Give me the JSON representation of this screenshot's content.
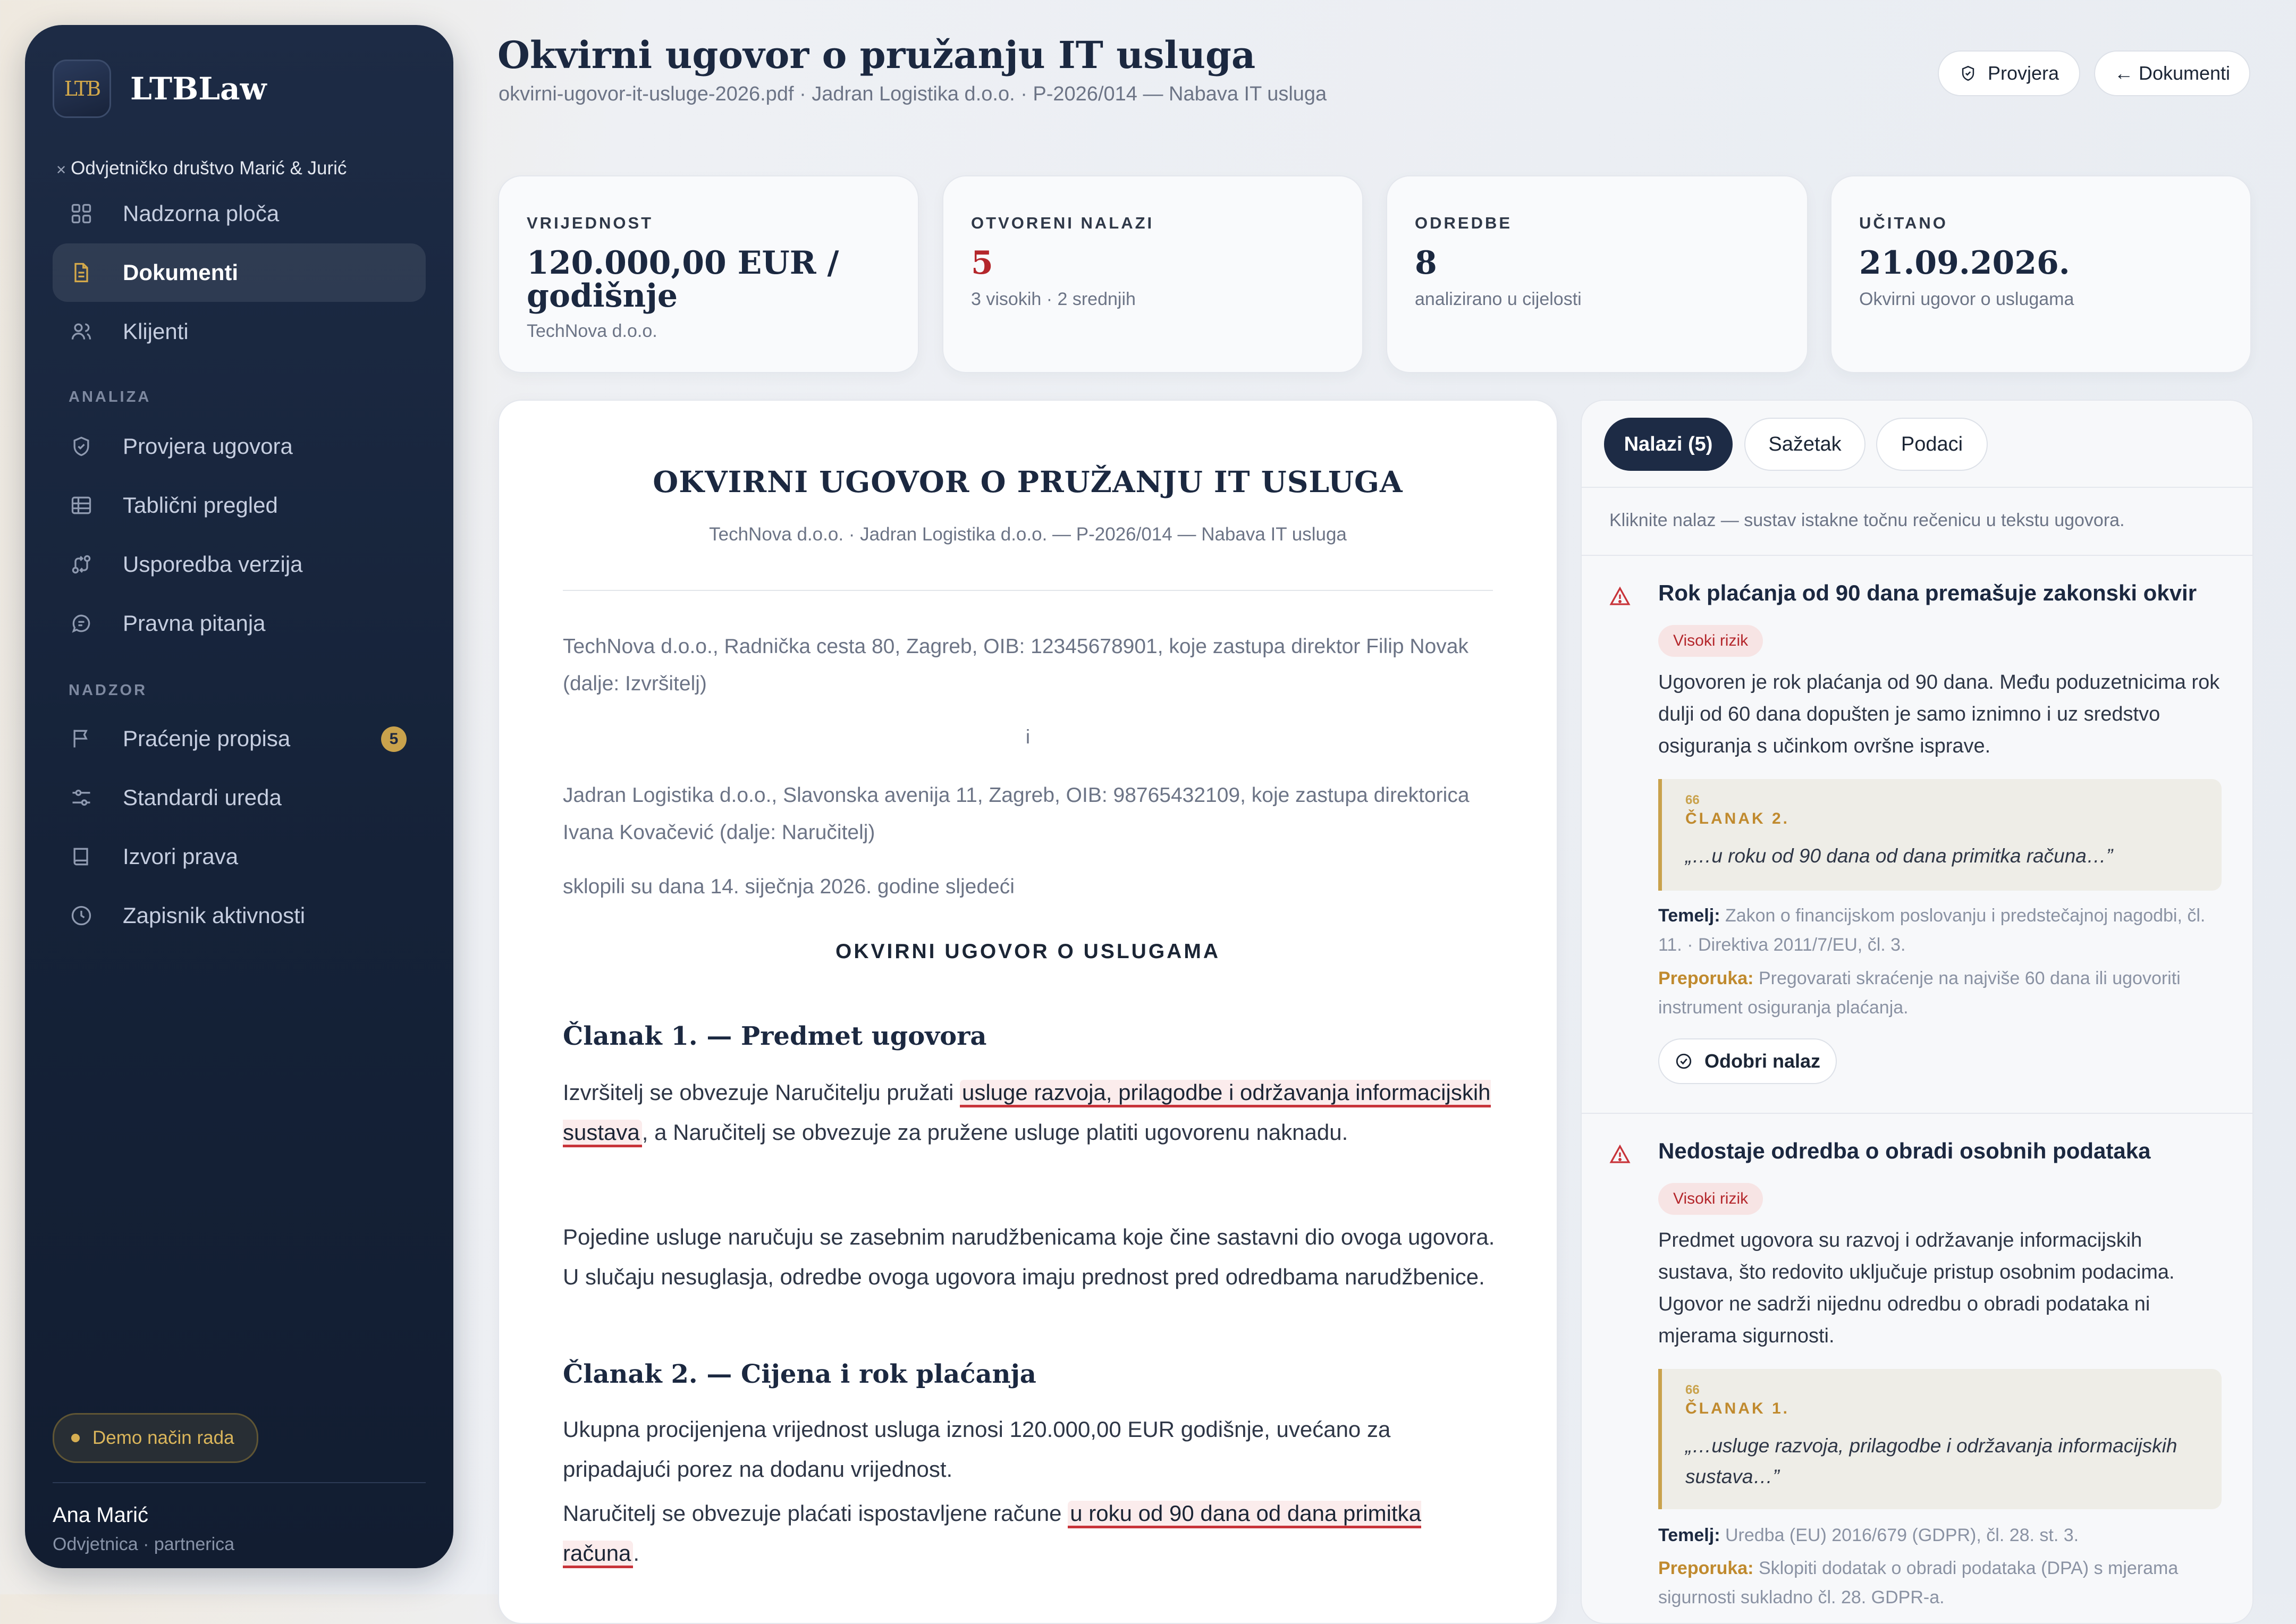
{
  "app": {
    "name": "LTBLaw",
    "logo_text": "LTB",
    "firm": "Odvjetničko društvo Marić & Jurić"
  },
  "nav": {
    "main": [
      {
        "label": "Nadzorna ploča",
        "icon": "dashboard-icon"
      },
      {
        "label": "Dokumenti",
        "icon": "document-icon",
        "active": true
      },
      {
        "label": "Klijenti",
        "icon": "users-icon"
      }
    ],
    "section_analysis": "ANALIZA",
    "analysis": [
      {
        "label": "Provjera ugovora",
        "icon": "shield-icon"
      },
      {
        "label": "Tablični pregled",
        "icon": "table-icon"
      },
      {
        "label": "Usporedba verzija",
        "icon": "compare-icon"
      },
      {
        "label": "Pravna pitanja",
        "icon": "chat-icon"
      }
    ],
    "section_monitor": "NADZOR",
    "monitor": [
      {
        "label": "Praćenje propisa",
        "icon": "flag-icon",
        "badge": "5"
      },
      {
        "label": "Standardi ureda",
        "icon": "sliders-icon"
      },
      {
        "label": "Izvori prava",
        "icon": "book-icon"
      },
      {
        "label": "Zapisnik aktivnosti",
        "icon": "clock-icon"
      }
    ]
  },
  "demo_mode": "Demo način rada",
  "user": {
    "name": "Ana Marić",
    "role": "Odvjetnica · partnerica"
  },
  "header": {
    "title": "Okvirni ugovor o pružanju IT usluga",
    "subtitle": "okvirni-ugovor-it-usluge-2026.pdf · Jadran Logistika d.o.o. · P-2026/014 — Nabava IT usluga",
    "check_button": "Provjera",
    "docs_button": "Dokumenti",
    "docs_arrow": "←"
  },
  "stats": [
    {
      "label": "VRIJEDNOST",
      "value": "120.000,00 EUR / godišnje",
      "note": "TechNova d.o.o."
    },
    {
      "label": "OTVORENI NALAZI",
      "value": "5",
      "note": "3 visokih · 2 srednjih"
    },
    {
      "label": "ODREDBE",
      "value": "8",
      "note": "analizirano u cijelosti"
    },
    {
      "label": "UČITANO",
      "value": "21.09.2026.",
      "note": "Okvirni ugovor o uslugama"
    }
  ],
  "document": {
    "title": "OKVIRNI UGOVOR O PRUŽANJU IT USLUGA",
    "subtitle": "TechNova d.o.o. · Jadran Logistika d.o.o. — P-2026/014 — Nabava IT usluga",
    "party1": "TechNova d.o.o., Radnička cesta 80, Zagreb, OIB: 12345678901, koje zastupa direktor Filip Novak (dalje: Izvršitelj)",
    "and": "i",
    "party2": "Jadran Logistika d.o.o., Slavonska avenija 11, Zagreb, OIB: 98765432109, koje zastupa direktorica Ivana Kovačević (dalje: Naručitelj)",
    "concluded": "sklopili su dana 14. siječnja 2026. godine sljedeći",
    "caps_title": "OKVIRNI UGOVOR O USLUGAMA",
    "art1_heading": "Članak 1. — Predmet ugovora",
    "art1_p1_before": "Izvršitelj se obvezuje Naručitelju pružati",
    "art1_p1_highlight": "usluge razvoja, prilagodbe i održavanja informacijskih sustava",
    "art1_p1_after": ", a Naručitelj se obvezuje za pružene usluge platiti ugovorenu naknadu.",
    "art1_p2": "Pojedine usluge naručuju se zasebnim narudžbenicama koje čine sastavni dio ovoga ugovora. U slučaju nesuglasja, odredbe ovoga ugovora imaju prednost pred odredbama narudžbenice.",
    "art2_heading": "Članak 2. — Cijena i rok plaćanja",
    "art2_p1": "Ukupna procijenjena vrijednost usluga iznosi 120.000,00 EUR godišnje, uvećano za pripadajući porez na dodanu vrijednost.",
    "art2_p2_before": "Naručitelj se obvezuje plaćati ispostavljene račune",
    "art2_p2_highlight": "u roku od 90 dana od dana primitka računa",
    "art2_p2_after": "."
  },
  "panel": {
    "tabs": [
      "Nalazi (5)",
      "Sažetak",
      "Podaci"
    ],
    "hint": "Kliknite nalaz — sustav istakne točnu rečenicu u tekstu ugovora.",
    "findings": [
      {
        "title": "Rok plaćanja od 90 dana premašuje zakonski okvir",
        "risk": "Visoki rizik",
        "text": "Ugovoren je rok plaćanja od 90 dana. Među poduzetnicima rok dulji od 60 dana dopušten je samo iznimno i uz sredstvo osiguranja s učinkom ovršne isprave.",
        "quote_mark": "66",
        "quote_label": "ČLANAK 2.",
        "quote": "„…u roku od 90 dana od dana primitka računa…”",
        "basis_label": "Temelj:",
        "basis": "Zakon o financijskom poslovanju i predstečajnoj nagodbi, čl. 11. · Direktiva 2011/7/EU, čl. 3.",
        "rec_label": "Preporuka:",
        "rec": "Pregovarati skraćenje na najviše 60 dana ili ugovoriti instrument osiguranja plaćanja.",
        "approve": "Odobri nalaz"
      },
      {
        "title": "Nedostaje odredba o obradi osobnih podataka",
        "risk": "Visoki rizik",
        "text": "Predmet ugovora su razvoj i održavanje informacijskih sustava, što redovito uključuje pristup osobnim podacima. Ugovor ne sadrži nijednu odredbu o obradi podataka ni mjerama sigurnosti.",
        "quote_mark": "66",
        "quote_label": "ČLANAK 1.",
        "quote": "„…usluge razvoja, prilagodbe i održavanja informacijskih sustava…”",
        "basis_label": "Temelj:",
        "basis": "Uredba (EU) 2016/679 (GDPR), čl. 28. st. 3.",
        "rec_label": "Preporuka:",
        "rec": "Sklopiti dodatak o obradi podataka (DPA) s mjerama sigurnosti sukladno čl. 28. GDPR-a."
      }
    ]
  }
}
